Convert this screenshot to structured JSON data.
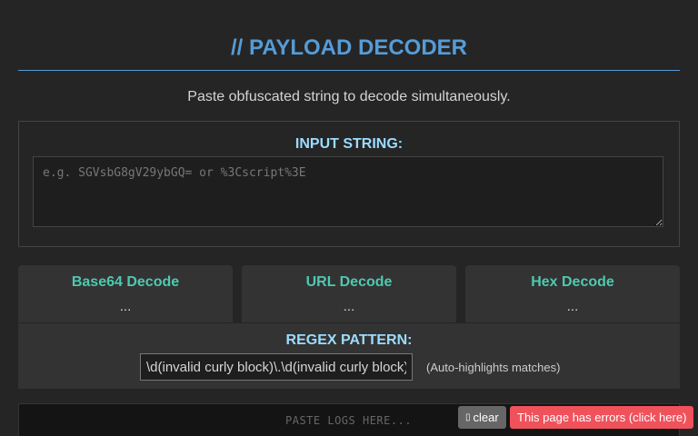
{
  "header": {
    "title": "// PAYLOAD DECODER",
    "subtitle": "Paste obfuscated string to decode simultaneously."
  },
  "input": {
    "label": "INPUT STRING:",
    "placeholder": "e.g. SGVsbG8gV29ybGQ= or %3Cscript%3E",
    "value": ""
  },
  "decoders": [
    {
      "title": "Base64 Decode",
      "output": "..."
    },
    {
      "title": "URL Decode",
      "output": "..."
    },
    {
      "title": "Hex Decode",
      "output": "..."
    }
  ],
  "regex": {
    "label": "REGEX PATTERN:",
    "value": "\\d(invalid curly block)\\.\\d(invalid curly block)",
    "hint": "(Auto-highlights matches)"
  },
  "logs": {
    "placeholder": "PASTE LOGS HERE..."
  },
  "overlay": {
    "clear_icon": "trash-icon",
    "clear_label": "clear",
    "error_label": "This page has errors (click here)"
  },
  "colors": {
    "background": "#252526",
    "title": "#569cd6",
    "label": "#9cdcfe",
    "decoder_title": "#4ec9b0",
    "error": "#f0525c"
  }
}
